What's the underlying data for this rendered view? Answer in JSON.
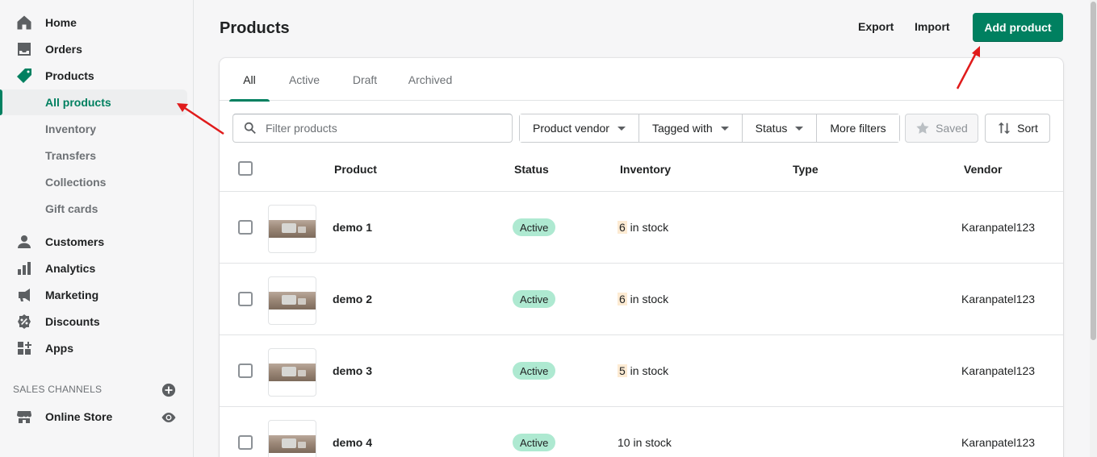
{
  "sidebar": {
    "nav": [
      {
        "label": "Home",
        "icon": "home-icon"
      },
      {
        "label": "Orders",
        "icon": "orders-icon"
      },
      {
        "label": "Products",
        "icon": "tag-icon"
      }
    ],
    "products_sub": [
      {
        "label": "All products",
        "selected": true
      },
      {
        "label": "Inventory"
      },
      {
        "label": "Transfers"
      },
      {
        "label": "Collections"
      },
      {
        "label": "Gift cards"
      }
    ],
    "nav2": [
      {
        "label": "Customers",
        "icon": "person-icon"
      },
      {
        "label": "Analytics",
        "icon": "bar-chart-icon"
      },
      {
        "label": "Marketing",
        "icon": "megaphone-icon"
      },
      {
        "label": "Discounts",
        "icon": "discount-icon"
      },
      {
        "label": "Apps",
        "icon": "apps-icon"
      }
    ],
    "sales_channels_heading": "SALES CHANNELS",
    "online_store": "Online Store"
  },
  "header": {
    "title": "Products",
    "export": "Export",
    "import": "Import",
    "add_product": "Add product"
  },
  "tabs": [
    "All",
    "Active",
    "Draft",
    "Archived"
  ],
  "filters": {
    "search_placeholder": "Filter products",
    "vendor": "Product vendor",
    "tagged": "Tagged with",
    "status": "Status",
    "more": "More filters",
    "saved": "Saved",
    "sort": "Sort"
  },
  "columns": {
    "product": "Product",
    "status": "Status",
    "inventory": "Inventory",
    "type": "Type",
    "vendor": "Vendor"
  },
  "rows": [
    {
      "name": "demo 1",
      "status": "Active",
      "stock_num": "6",
      "stock_text": " in stock",
      "vendor": "Karanpatel123"
    },
    {
      "name": "demo 2",
      "status": "Active",
      "stock_num": "6",
      "stock_text": " in stock",
      "vendor": "Karanpatel123"
    },
    {
      "name": "demo 3",
      "status": "Active",
      "stock_num": "5",
      "stock_text": " in stock",
      "vendor": "Karanpatel123"
    },
    {
      "name": "demo 4",
      "status": "Active",
      "stock_num": "10",
      "stock_text": " in stock",
      "vendor": "Karanpatel123"
    }
  ],
  "colors": {
    "accent": "#008060",
    "badge_active": "#aee9d1",
    "annotation_arrow": "#e01b1b"
  }
}
